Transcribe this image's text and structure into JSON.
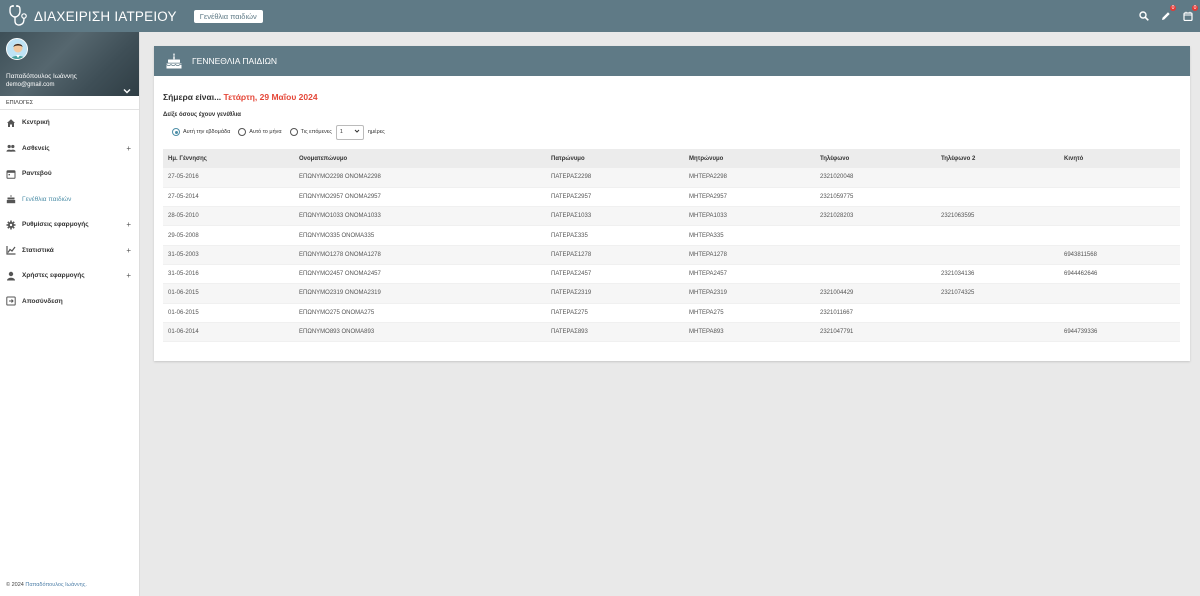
{
  "header": {
    "app_title": "ΔΙΑΧΕΙΡΙΣΗ ΙΑΤΡΕΙΟΥ",
    "breadcrumb": "Γενέθλια παιδιών",
    "icons": [
      "search-icon",
      "pen-icon",
      "calendar-icon"
    ],
    "badges": {
      "pen": "0",
      "calendar": "0"
    }
  },
  "sidebar": {
    "user_name": "Παπαδόπουλος Ιωάννης",
    "user_email": "demo@gmail.com",
    "section_label": "ΕΠΙΛΟΓΕΣ",
    "items": [
      {
        "label": "Κεντρική",
        "icon": "home-icon",
        "expandable": false
      },
      {
        "label": "Ασθενείς",
        "icon": "people-icon",
        "expandable": true
      },
      {
        "label": "Ραντεβού",
        "icon": "calendar-icon",
        "expandable": false
      },
      {
        "label": "Γενέθλια παιδιών",
        "icon": "cake-icon",
        "expandable": false,
        "active": true
      },
      {
        "label": "Ρυθμίσεις εφαρμογής",
        "icon": "gear-icon",
        "expandable": true
      },
      {
        "label": "Στατιστικά",
        "icon": "chart-icon",
        "expandable": true
      },
      {
        "label": "Χρήστες εφαρμογής",
        "icon": "person-icon",
        "expandable": true
      },
      {
        "label": "Αποσύνδεση",
        "icon": "logout-icon",
        "expandable": false
      }
    ],
    "footer_prefix": "© 2024",
    "footer_link": "Παπαδόπουλος Ιωάννης."
  },
  "main": {
    "card_title": "ΓΕΝΝΕΘΛΙΑ ΠΑΙΔΙΩΝ",
    "today_prefix": "Σήμερα είναι...",
    "today_date": "Τετάρτη, 29 Μαΐου 2024",
    "show_label": "Δείξε όσους έχουν γενέθλια",
    "options": {
      "week": "Αυτή την εβδομάδα",
      "month": "Αυτό το μήνα",
      "next": "Τις επόμενες",
      "select_value": "1",
      "days": "ημέρες",
      "selected": "week"
    },
    "table": {
      "headers": [
        "Ημ. Γέννησης",
        "Ονοματεπώνυμο",
        "Πατρώνυμο",
        "Μητρώνυμο",
        "Τηλέφωνο",
        "Τηλέφωνο 2",
        "Κινητό"
      ],
      "rows": [
        [
          "27-05-2016",
          "ΕΠΩΝΥΜΟ2298 ΟΝΟΜΑ2298",
          "ΠΑΤΕΡΑΣ2298",
          "ΜΗΤΕΡΑ2298",
          "2321020048",
          "",
          ""
        ],
        [
          "27-05-2014",
          "ΕΠΩΝΥΜΟ2957 ΟΝΟΜΑ2957",
          "ΠΑΤΕΡΑΣ2957",
          "ΜΗΤΕΡΑ2957",
          "2321059775",
          "",
          ""
        ],
        [
          "28-05-2010",
          "ΕΠΩΝΥΜΟ1033 ΟΝΟΜΑ1033",
          "ΠΑΤΕΡΑΣ1033",
          "ΜΗΤΕΡΑ1033",
          "2321028203",
          "2321063595",
          ""
        ],
        [
          "29-05-2008",
          "ΕΠΩΝΥΜΟ335 ΟΝΟΜΑ335",
          "ΠΑΤΕΡΑΣ335",
          "ΜΗΤΕΡΑ335",
          "",
          "",
          ""
        ],
        [
          "31-05-2003",
          "ΕΠΩΝΥΜΟ1278 ΟΝΟΜΑ1278",
          "ΠΑΤΕΡΑΣ1278",
          "ΜΗΤΕΡΑ1278",
          "",
          "",
          "6943811568"
        ],
        [
          "31-05-2016",
          "ΕΠΩΝΥΜΟ2457 ΟΝΟΜΑ2457",
          "ΠΑΤΕΡΑΣ2457",
          "ΜΗΤΕΡΑ2457",
          "",
          "2321034136",
          "6944462646"
        ],
        [
          "01-06-2015",
          "ΕΠΩΝΥΜΟ2319 ΟΝΟΜΑ2319",
          "ΠΑΤΕΡΑΣ2319",
          "ΜΗΤΕΡΑ2319",
          "2321004429",
          "2321074325",
          ""
        ],
        [
          "01-06-2015",
          "ΕΠΩΝΥΜΟ275 ΟΝΟΜΑ275",
          "ΠΑΤΕΡΑΣ275",
          "ΜΗΤΕΡΑ275",
          "2321011667",
          "",
          ""
        ],
        [
          "01-06-2014",
          "ΕΠΩΝΥΜΟ893 ΟΝΟΜΑ893",
          "ΠΑΤΕΡΑΣ893",
          "ΜΗΤΕΡΑ893",
          "2321047791",
          "",
          "6944739336"
        ]
      ]
    }
  },
  "colors": {
    "header_bg": "#5f7a86",
    "accent": "#4e8fa8",
    "date_red": "#e5483a",
    "badge_red": "#e53935"
  }
}
